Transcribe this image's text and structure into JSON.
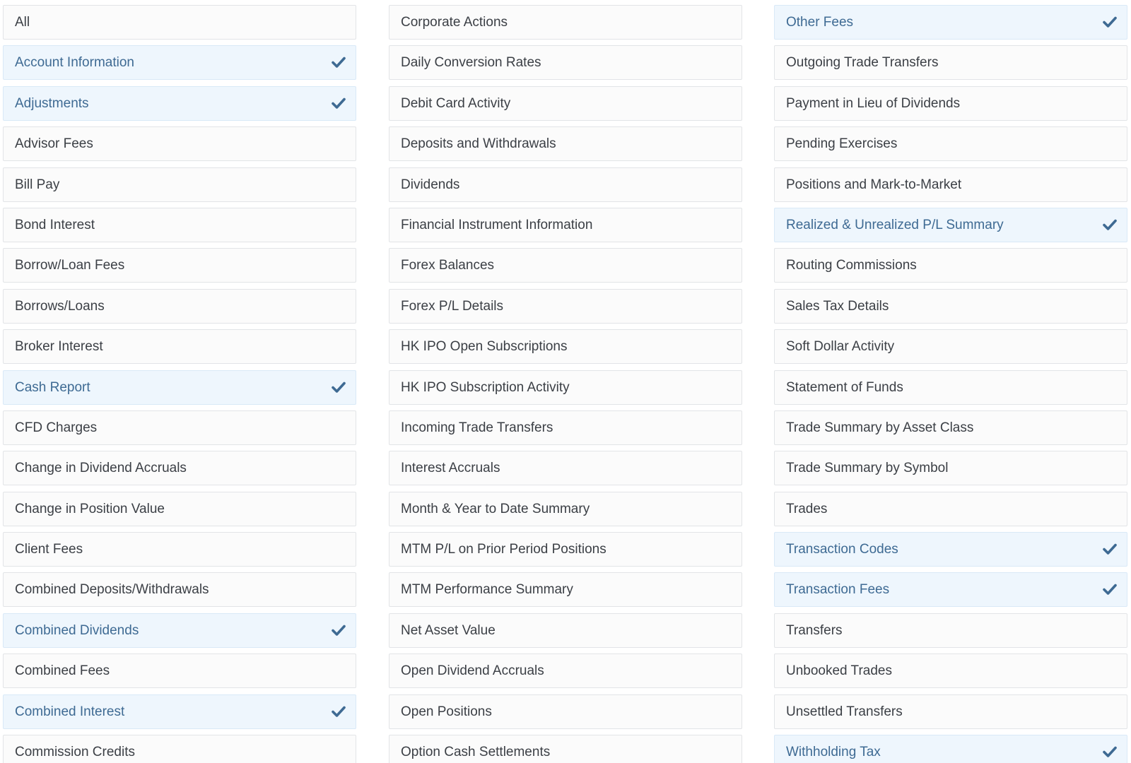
{
  "colors": {
    "selected_background": "#eef6fd",
    "selected_text": "#3e6a93",
    "check": "#3e6a93",
    "default_text": "#3b3f45",
    "default_background": "#fbfbfb",
    "border": "#e2e4e7"
  },
  "check_icon": "checkmark-icon",
  "columns": [
    {
      "items": [
        {
          "label": "All",
          "selected": false
        },
        {
          "label": "Account Information",
          "selected": true
        },
        {
          "label": "Adjustments",
          "selected": true
        },
        {
          "label": "Advisor Fees",
          "selected": false
        },
        {
          "label": "Bill Pay",
          "selected": false
        },
        {
          "label": "Bond Interest",
          "selected": false
        },
        {
          "label": "Borrow/Loan Fees",
          "selected": false
        },
        {
          "label": "Borrows/Loans",
          "selected": false
        },
        {
          "label": "Broker Interest",
          "selected": false
        },
        {
          "label": "Cash Report",
          "selected": true
        },
        {
          "label": "CFD Charges",
          "selected": false
        },
        {
          "label": "Change in Dividend Accruals",
          "selected": false
        },
        {
          "label": "Change in Position Value",
          "selected": false
        },
        {
          "label": "Client Fees",
          "selected": false
        },
        {
          "label": "Combined Deposits/Withdrawals",
          "selected": false
        },
        {
          "label": "Combined Dividends",
          "selected": true
        },
        {
          "label": "Combined Fees",
          "selected": false
        },
        {
          "label": "Combined Interest",
          "selected": true
        },
        {
          "label": "Commission Credits",
          "selected": false
        }
      ]
    },
    {
      "items": [
        {
          "label": "Corporate Actions",
          "selected": false
        },
        {
          "label": "Daily Conversion Rates",
          "selected": false
        },
        {
          "label": "Debit Card Activity",
          "selected": false
        },
        {
          "label": "Deposits and Withdrawals",
          "selected": false
        },
        {
          "label": "Dividends",
          "selected": false
        },
        {
          "label": "Financial Instrument Information",
          "selected": false
        },
        {
          "label": "Forex Balances",
          "selected": false
        },
        {
          "label": "Forex P/L Details",
          "selected": false
        },
        {
          "label": "HK IPO Open Subscriptions",
          "selected": false
        },
        {
          "label": "HK IPO Subscription Activity",
          "selected": false
        },
        {
          "label": "Incoming Trade Transfers",
          "selected": false
        },
        {
          "label": "Interest Accruals",
          "selected": false
        },
        {
          "label": "Month & Year to Date Summary",
          "selected": false
        },
        {
          "label": "MTM P/L on Prior Period Positions",
          "selected": false
        },
        {
          "label": "MTM Performance Summary",
          "selected": false
        },
        {
          "label": "Net Asset Value",
          "selected": false
        },
        {
          "label": "Open Dividend Accruals",
          "selected": false
        },
        {
          "label": "Open Positions",
          "selected": false
        },
        {
          "label": "Option Cash Settlements",
          "selected": false
        }
      ]
    },
    {
      "items": [
        {
          "label": "Other Fees",
          "selected": true
        },
        {
          "label": "Outgoing Trade Transfers",
          "selected": false
        },
        {
          "label": "Payment in Lieu of Dividends",
          "selected": false
        },
        {
          "label": "Pending Exercises",
          "selected": false
        },
        {
          "label": "Positions and Mark-to-Market",
          "selected": false
        },
        {
          "label": "Realized & Unrealized P/L Summary",
          "selected": true
        },
        {
          "label": "Routing Commissions",
          "selected": false
        },
        {
          "label": "Sales Tax Details",
          "selected": false
        },
        {
          "label": "Soft Dollar Activity",
          "selected": false
        },
        {
          "label": "Statement of Funds",
          "selected": false
        },
        {
          "label": "Trade Summary by Asset Class",
          "selected": false
        },
        {
          "label": "Trade Summary by Symbol",
          "selected": false
        },
        {
          "label": "Trades",
          "selected": false
        },
        {
          "label": "Transaction Codes",
          "selected": true
        },
        {
          "label": "Transaction Fees",
          "selected": true
        },
        {
          "label": "Transfers",
          "selected": false
        },
        {
          "label": "Unbooked Trades",
          "selected": false
        },
        {
          "label": "Unsettled Transfers",
          "selected": false
        },
        {
          "label": "Withholding Tax",
          "selected": true
        }
      ]
    }
  ]
}
